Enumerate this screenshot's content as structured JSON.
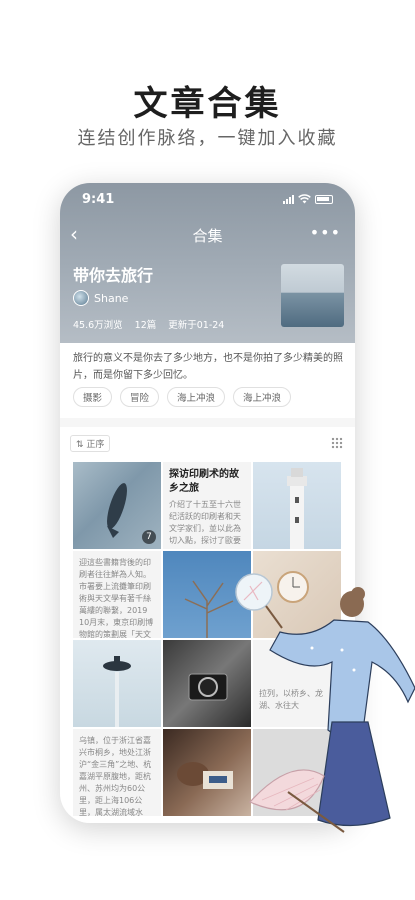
{
  "promo": {
    "title": "文章合集",
    "subtitle": "连结创作脉络，一键加入收藏"
  },
  "status_bar": {
    "time": "9:41"
  },
  "nav": {
    "title": "合集"
  },
  "collection": {
    "title": "带你去旅行",
    "author": "Shane",
    "views": "45.6万浏览",
    "count": "12篇",
    "updated": "更新于01-24",
    "intro": "旅行的意义不是你去了多少地方，也不是你拍了多少精美的照片，而是你留下多少回忆。",
    "tags": [
      "摄影",
      "冒险",
      "海上冲浪",
      "海上冲浪"
    ]
  },
  "list": {
    "sort_label": "正序",
    "cells": [
      {
        "badge": "7"
      },
      {
        "title": "探访印刷术的故乡之旅",
        "body": "介绍了十五至十六世纪活跃的印刷者和天文学家们，並以此為切入點，探讨了歐要"
      },
      {
        "body": "迎這些書籍背後的印刷者往往鮮為人知。市署要上流攤筆印刷術與天文學有著千絲萬縷的聯繫，2019 10月末，東京印刷博物館的策劃展「天文"
      },
      {
        "body": "乌镇，位于浙江省嘉兴市桐乡，地处江浙沪“金三角”之地、杭嘉湖平原腹地，距杭州、苏州均为60公里，距上海106公里，属太湖流域水"
      },
      {
        "body": "拉列，以桥乡、龙湖、水往大"
      }
    ]
  },
  "colors": {
    "header_top": "#8d98a3",
    "header_bottom": "#b5bdc5",
    "illustration_robe": "#a9c6e8",
    "illustration_skirt": "#4a5c9c"
  }
}
